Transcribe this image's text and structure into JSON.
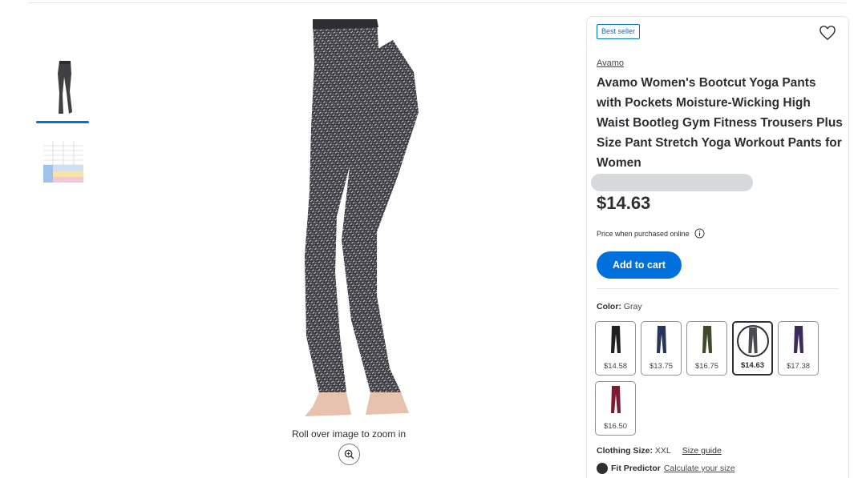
{
  "gallery": {
    "zoom_hint": "Roll over image to zoom in",
    "thumbnails": [
      "product-photo",
      "size-chart"
    ],
    "active_thumbnail": 0
  },
  "product": {
    "badge": "Best seller",
    "brand": "Avamo",
    "title": "Avamo Women's Bootcut Yoga Pants with Pockets Moisture-Wicking High Waist Bootleg Gym Fitness Trousers Plus Size Pant Stretch Yoga Workout Pants for Women",
    "price": "$14.63",
    "price_note": "Price when purchased online",
    "add_to_cart": "Add to cart"
  },
  "color": {
    "label": "Color:",
    "selected": "Gray",
    "swatches": [
      {
        "name": "black",
        "price": "$14.58",
        "hex": "#1f1f22"
      },
      {
        "name": "navy",
        "price": "$13.75",
        "hex": "#25365a"
      },
      {
        "name": "olive",
        "price": "$16.75",
        "hex": "#3f4a28"
      },
      {
        "name": "gray",
        "price": "$14.63",
        "hex": "#4a4a50",
        "selected": true
      },
      {
        "name": "purple",
        "price": "$17.38",
        "hex": "#3b2a5c"
      },
      {
        "name": "burgundy",
        "price": "$16.50",
        "hex": "#7a1a33"
      }
    ]
  },
  "size": {
    "label": "Clothing Size:",
    "value": "XXL",
    "guide": "Size guide"
  },
  "fit": {
    "label": "Fit Predictor",
    "link": "Calculate your size"
  },
  "colors": {
    "accent": "#0071dc",
    "text": "#2e2f32"
  }
}
